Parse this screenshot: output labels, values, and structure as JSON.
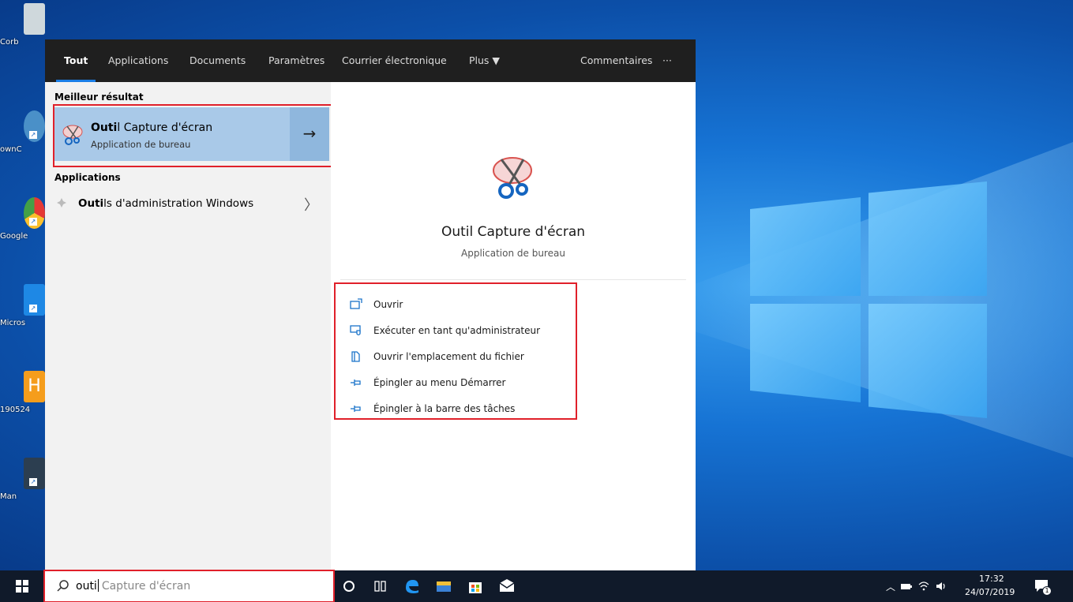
{
  "desktop": {
    "icons": [
      {
        "label": "Corb",
        "color": "#cfd8dc"
      },
      {
        "label": "ownC",
        "color": "#4a90c8"
      },
      {
        "label": "Google",
        "color": "#e53935"
      },
      {
        "label": "Micros",
        "color": "#1e88e5"
      },
      {
        "label": "190524",
        "color": "#f59d1c"
      },
      {
        "label": "Man",
        "color": "#2c3e50"
      }
    ]
  },
  "tabs": [
    {
      "label": "Tout",
      "active": true
    },
    {
      "label": "Applications"
    },
    {
      "label": "Documents"
    },
    {
      "label": "Paramètres"
    },
    {
      "label": "Courrier électronique"
    },
    {
      "label": "Plus ▼"
    },
    {
      "label": "Commentaires"
    },
    {
      "label": "···"
    }
  ],
  "results": {
    "best_heading": "Meilleur résultat",
    "best": {
      "title_match": "Outi",
      "title_rest": "l Capture d'écran",
      "subtitle": "Application de bureau",
      "arrow": "→"
    },
    "apps_heading": "Applications",
    "apps": [
      {
        "match": "Outi",
        "rest": "ls d'administration Windows",
        "chevron": "〉"
      }
    ]
  },
  "detail": {
    "title": "Outil Capture d'écran",
    "subtitle": "Application de bureau",
    "actions": [
      {
        "label": "Ouvrir",
        "icon": "open-icon"
      },
      {
        "label": "Exécuter en tant qu'administrateur",
        "icon": "run-as-admin-icon"
      },
      {
        "label": "Ouvrir l'emplacement du fichier",
        "icon": "file-location-icon"
      },
      {
        "label": "Épingler au menu Démarrer",
        "icon": "pin-icon"
      },
      {
        "label": "Épingler à la barre des tâches",
        "icon": "pin-icon"
      }
    ]
  },
  "search": {
    "typed": "outi",
    "suggestion": "Capture d'écran"
  },
  "tray": {
    "time": "17:32",
    "date": "24/07/2019",
    "notifications": "1"
  },
  "colors": {
    "accent": "#1a7ee6",
    "highlight": "#e0202a",
    "selected": "#a9c9e8"
  }
}
